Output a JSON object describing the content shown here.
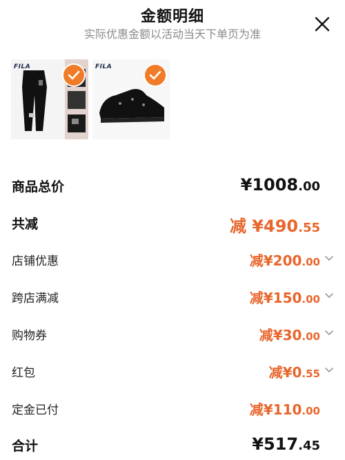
{
  "header": {
    "title": "金额明细",
    "subtitle": "实际优惠金额以活动当天下单页为准"
  },
  "products": [
    {
      "brand": "FILA",
      "name_icon": "pants-image"
    },
    {
      "brand": "FILA",
      "name_icon": "sneaker-image"
    }
  ],
  "summary": {
    "total": {
      "label": "商品总价",
      "currency": "¥",
      "int": "1008",
      "dec": ".00"
    },
    "reduced": {
      "label": "共减",
      "prefix": "减",
      "currency": "¥",
      "int": "490",
      "dec": ".55"
    },
    "items": [
      {
        "label": "店铺优惠",
        "prefix": "减",
        "currency": "¥",
        "int": "200",
        "dec": ".00"
      },
      {
        "label": "跨店满减",
        "prefix": "减",
        "currency": "¥",
        "int": "150",
        "dec": ".00"
      },
      {
        "label": "购物券",
        "prefix": "减",
        "currency": "¥",
        "int": "30",
        "dec": ".00"
      },
      {
        "label": "红包",
        "prefix": "减",
        "currency": "¥",
        "int": "0",
        "dec": ".55"
      },
      {
        "label": "定金已付",
        "prefix": "减",
        "currency": "¥",
        "int": "110",
        "dec": ".00"
      }
    ],
    "grand_total": {
      "label": "合计",
      "currency": "¥",
      "int": "517",
      "dec": ".45"
    }
  },
  "colors": {
    "accent": "#e8662c",
    "check": "#f07c2a"
  }
}
